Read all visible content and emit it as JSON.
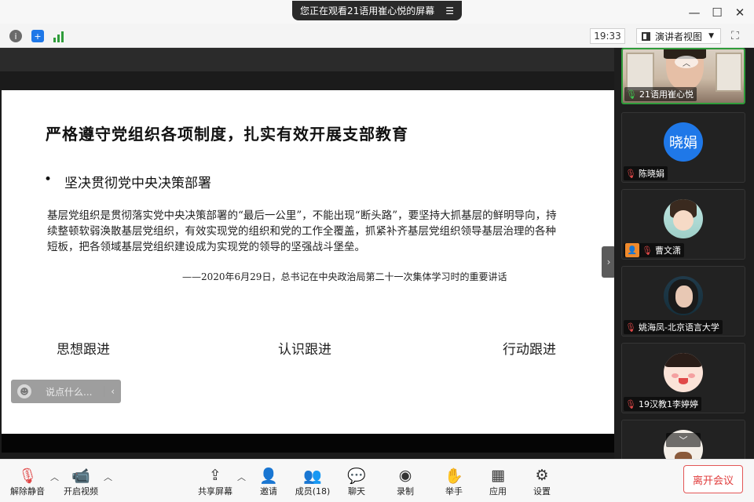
{
  "title_bar": {
    "share_notice": "您正在观看21语用崔心悦的屏幕"
  },
  "info_bar": {
    "time": "19:33",
    "view_mode": "演讲者视图"
  },
  "slide": {
    "title": "严格遵守党组织各项制度，扎实有效开展支部教育",
    "bullet": "坚决贯彻党中央决策部署",
    "paragraph": "基层党组织是贯彻落实党中央决策部署的“最后一公里”，不能出现“断头路”，要坚持大抓基层的鲜明导向，持续整顿软弱涣散基层党组织，有效实现党的组织和党的工作全覆盖，抓紧补齐基层党组织领导基层治理的各种短板，把各领域基层党组织建设成为实现党的领导的坚强战斗堡垒。",
    "quote": "——2020年6月29日，总书记在中央政治局第二十一次集体学习时的重要讲话",
    "footer": [
      "思想跟进",
      "认识跟进",
      "行动跟进"
    ]
  },
  "chat": {
    "placeholder": "说点什么..."
  },
  "participants": [
    {
      "name": "21语用崔心悦",
      "avatar_text": "",
      "mic": "on",
      "active": true
    },
    {
      "name": "陈晓娟",
      "avatar_text": "晓娟",
      "mic": "off",
      "active": false
    },
    {
      "name": "曹文潇",
      "avatar_text": "",
      "mic": "off",
      "active": false
    },
    {
      "name": "姚海凤-北京语言大学",
      "avatar_text": "",
      "mic": "off",
      "active": false
    },
    {
      "name": "19汉教1李婷婷",
      "avatar_text": "",
      "mic": "off",
      "active": false
    }
  ],
  "toolbar": {
    "unmute": "解除静音",
    "start_video": "开启视频",
    "share_screen": "共享屏幕",
    "invite": "邀请",
    "members": "成员(18)",
    "chat": "聊天",
    "record": "录制",
    "raise_hand": "举手",
    "apps": "应用",
    "settings": "设置",
    "leave": "离开会议"
  },
  "colors": {
    "active_speaker": "#2f9c3a",
    "leave": "#e03c3c",
    "avatar_blue": "#1f78e8",
    "mute_red": "#e04848"
  }
}
